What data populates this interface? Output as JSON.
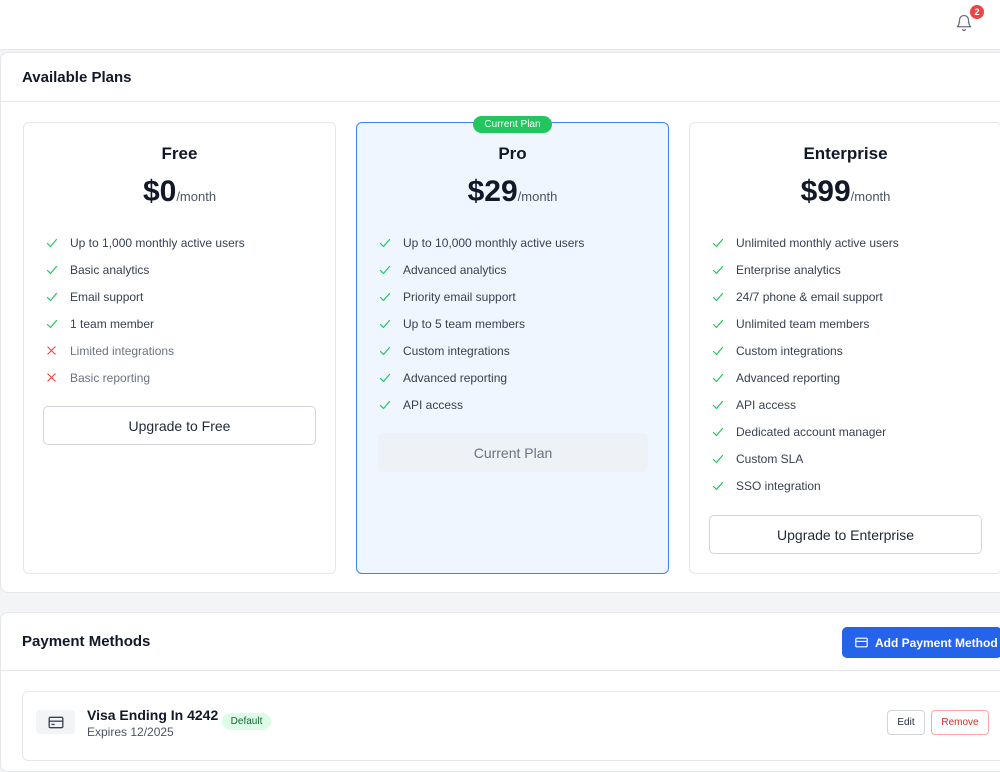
{
  "header": {
    "notification_count": "2",
    "icon": "bell-icon"
  },
  "plans_section": {
    "title": "Available Plans",
    "plans": [
      {
        "name": "Free",
        "price": "$0",
        "period": "/month",
        "features": [
          {
            "text": "Up to 1,000 monthly active users",
            "included": true
          },
          {
            "text": "Basic analytics",
            "included": true
          },
          {
            "text": "Email support",
            "included": true
          },
          {
            "text": "1 team member",
            "included": true
          },
          {
            "text": "Limited integrations",
            "included": false
          },
          {
            "text": "Basic reporting",
            "included": false
          }
        ],
        "button_label": "Upgrade to Free"
      },
      {
        "name": "Pro",
        "price": "$29",
        "period": "/month",
        "badge": "Current Plan",
        "features": [
          {
            "text": "Up to 10,000 monthly active users",
            "included": true
          },
          {
            "text": "Advanced analytics",
            "included": true
          },
          {
            "text": "Priority email support",
            "included": true
          },
          {
            "text": "Up to 5 team members",
            "included": true
          },
          {
            "text": "Custom integrations",
            "included": true
          },
          {
            "text": "Advanced reporting",
            "included": true
          },
          {
            "text": "API access",
            "included": true
          }
        ],
        "button_label": "Current Plan"
      },
      {
        "name": "Enterprise",
        "price": "$99",
        "period": "/month",
        "features": [
          {
            "text": "Unlimited monthly active users",
            "included": true
          },
          {
            "text": "Enterprise analytics",
            "included": true
          },
          {
            "text": "24/7 phone & email support",
            "included": true
          },
          {
            "text": "Unlimited team members",
            "included": true
          },
          {
            "text": "Custom integrations",
            "included": true
          },
          {
            "text": "Advanced reporting",
            "included": true
          },
          {
            "text": "API access",
            "included": true
          },
          {
            "text": "Dedicated account manager",
            "included": true
          },
          {
            "text": "Custom SLA",
            "included": true
          },
          {
            "text": "SSO integration",
            "included": true
          }
        ],
        "button_label": "Upgrade to Enterprise"
      }
    ]
  },
  "payment_section": {
    "title": "Payment Methods",
    "add_button_label": "Add Payment Method",
    "methods": [
      {
        "name": "Visa Ending In 4242",
        "expires": "Expires 12/2025",
        "badge": "Default",
        "edit_label": "Edit",
        "remove_label": "Remove"
      }
    ]
  },
  "colors": {
    "accent": "#2563eb",
    "current_plan_border": "#3b82f6",
    "check": "#22c55e",
    "cross": "#ef4444"
  }
}
